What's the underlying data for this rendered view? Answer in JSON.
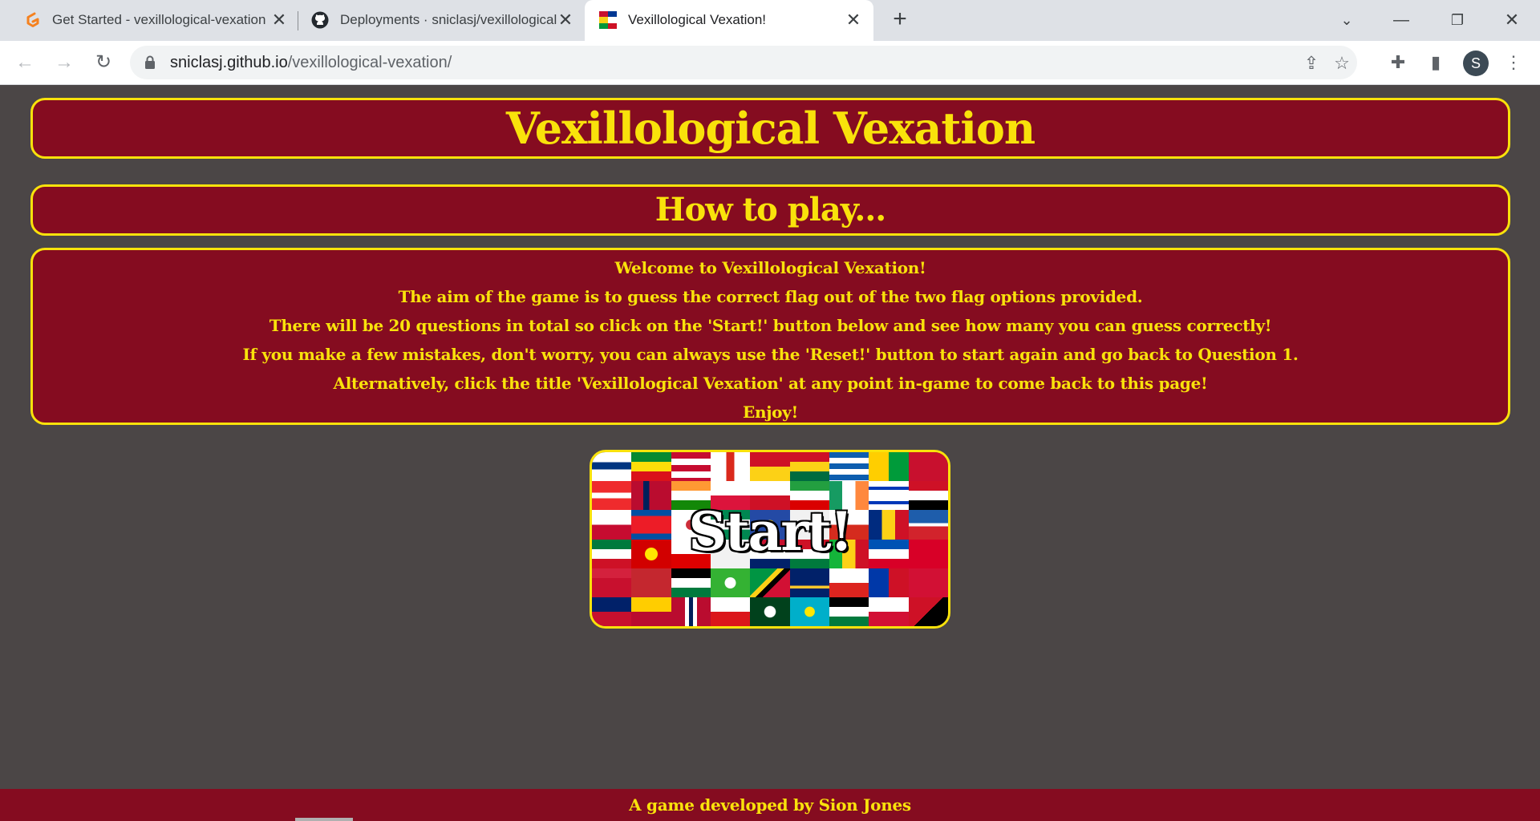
{
  "browser": {
    "tabs": [
      {
        "title": "Get Started - vexillological-vexation",
        "icon": "gitpod-icon"
      },
      {
        "title": "Deployments · sniclasj/vexillological-vexation",
        "icon": "github-icon"
      },
      {
        "title": "Vexillological Vexation!",
        "icon": "flags-favicon"
      }
    ],
    "url_host": "sniclasj.github.io",
    "url_path": "/vexillological-vexation/",
    "profile_initial": "S"
  },
  "page": {
    "title": "Vexillological Vexation",
    "how_to_heading": "How to play...",
    "instructions": [
      "Welcome to Vexillological Vexation!",
      "The aim of the game is to guess the correct flag out of the two flag options provided.",
      "There will be 20 questions in total so click on the 'Start!' button below and see how many you can guess correctly!",
      "If you make a few mistakes, don't worry, you can always use the 'Reset!' button to start again and go back to Question 1.",
      "Alternatively, click the title 'Vexillological Vexation' at any point in-game to come back to this page!",
      "Enjoy!"
    ],
    "start_label": "Start!",
    "footer": "A game developed by Sion Jones"
  },
  "colors": {
    "background": "#4b4646",
    "panel": "#850c20",
    "accent": "#f9e20b"
  }
}
